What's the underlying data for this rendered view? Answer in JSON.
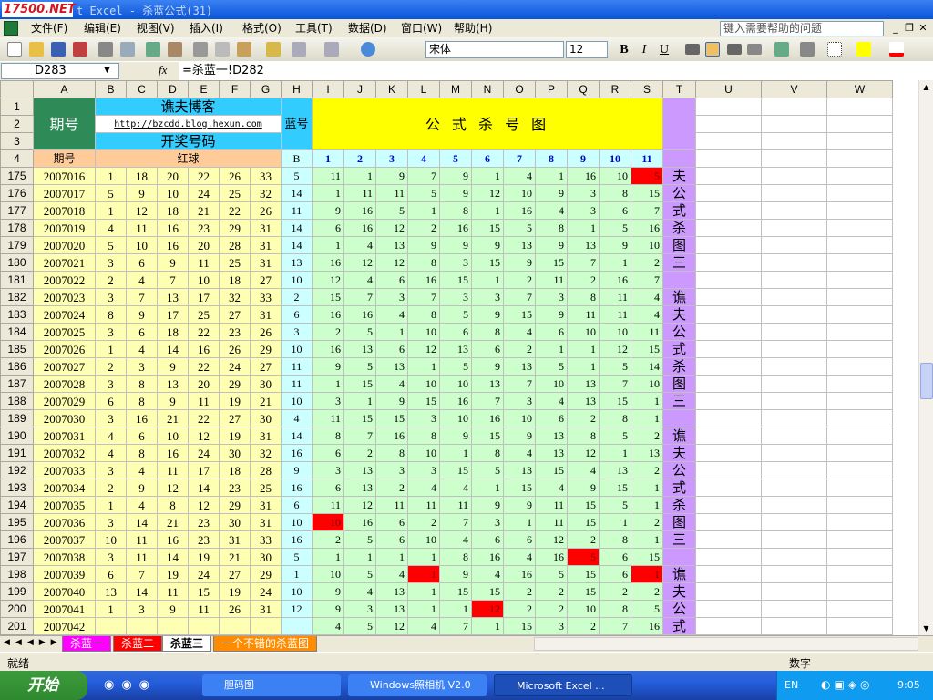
{
  "window": {
    "logo": "17500.NET",
    "title": "t Excel - 杀蓝公式(31)"
  },
  "menu": {
    "items": [
      "文件(F)",
      "编辑(E)",
      "视图(V)",
      "插入(I)",
      "格式(O)",
      "工具(T)",
      "数据(D)",
      "窗口(W)",
      "帮助(H)"
    ],
    "help_placeholder": "键入需要帮助的问题"
  },
  "toolbar": {
    "font": "宋体",
    "size": "12",
    "bold": "B",
    "italic": "I",
    "underline": "U"
  },
  "formula": {
    "namebox": "D283",
    "fx": "fx",
    "value": "=杀蓝一!D282"
  },
  "columns": [
    "A",
    "B",
    "C",
    "D",
    "E",
    "F",
    "G",
    "H",
    "I",
    "J",
    "K",
    "L",
    "M",
    "N",
    "O",
    "P",
    "Q",
    "R",
    "S",
    "T",
    "U",
    "V",
    "W"
  ],
  "header": {
    "period": "期号",
    "blog": "谯夫博客",
    "url": "http://bzcdd.blog.hexun.com",
    "draw": "开奖号码",
    "blue": "蓝号",
    "formula_title": "公 式 杀 号 图",
    "period2": "期号",
    "red": "红球",
    "B": "B",
    "nums": [
      "1",
      "2",
      "3",
      "4",
      "5",
      "6",
      "7",
      "8",
      "9",
      "10",
      "11"
    ]
  },
  "rows": [
    {
      "r": "175",
      "p": "2007016",
      "red": [
        "1",
        "18",
        "20",
        "22",
        "26",
        "33"
      ],
      "b": "5",
      "v": [
        "11",
        "1",
        "9",
        "7",
        "9",
        "1",
        "4",
        "1",
        "16",
        "10",
        "5"
      ],
      "hl": [
        10
      ]
    },
    {
      "r": "176",
      "p": "2007017",
      "red": [
        "5",
        "9",
        "10",
        "24",
        "25",
        "32"
      ],
      "b": "14",
      "v": [
        "1",
        "11",
        "11",
        "5",
        "9",
        "12",
        "10",
        "9",
        "3",
        "8",
        "15"
      ],
      "hl": []
    },
    {
      "r": "177",
      "p": "2007018",
      "red": [
        "1",
        "12",
        "18",
        "21",
        "22",
        "26"
      ],
      "b": "11",
      "v": [
        "9",
        "16",
        "5",
        "1",
        "8",
        "1",
        "16",
        "4",
        "3",
        "6",
        "7"
      ],
      "hl": []
    },
    {
      "r": "178",
      "p": "2007019",
      "red": [
        "4",
        "11",
        "16",
        "23",
        "29",
        "31"
      ],
      "b": "14",
      "v": [
        "6",
        "16",
        "12",
        "2",
        "16",
        "15",
        "5",
        "8",
        "1",
        "5",
        "16"
      ],
      "hl": []
    },
    {
      "r": "179",
      "p": "2007020",
      "red": [
        "5",
        "10",
        "16",
        "20",
        "28",
        "31"
      ],
      "b": "14",
      "v": [
        "1",
        "4",
        "13",
        "9",
        "9",
        "9",
        "13",
        "9",
        "13",
        "9",
        "10"
      ],
      "hl": []
    },
    {
      "r": "180",
      "p": "2007021",
      "red": [
        "3",
        "6",
        "9",
        "11",
        "25",
        "31"
      ],
      "b": "13",
      "v": [
        "16",
        "12",
        "12",
        "8",
        "3",
        "15",
        "9",
        "15",
        "7",
        "1",
        "2"
      ],
      "hl": []
    },
    {
      "r": "181",
      "p": "2007022",
      "red": [
        "2",
        "4",
        "7",
        "10",
        "18",
        "27"
      ],
      "b": "10",
      "v": [
        "12",
        "4",
        "6",
        "16",
        "15",
        "1",
        "2",
        "11",
        "2",
        "16",
        "7"
      ],
      "hl": []
    },
    {
      "r": "182",
      "p": "2007023",
      "red": [
        "3",
        "7",
        "13",
        "17",
        "32",
        "33"
      ],
      "b": "2",
      "v": [
        "15",
        "7",
        "3",
        "7",
        "3",
        "3",
        "7",
        "3",
        "8",
        "11",
        "4"
      ],
      "hl": []
    },
    {
      "r": "183",
      "p": "2007024",
      "red": [
        "8",
        "9",
        "17",
        "25",
        "27",
        "31"
      ],
      "b": "6",
      "v": [
        "16",
        "16",
        "4",
        "8",
        "5",
        "9",
        "15",
        "9",
        "11",
        "11",
        "4"
      ],
      "hl": []
    },
    {
      "r": "184",
      "p": "2007025",
      "red": [
        "3",
        "6",
        "18",
        "22",
        "23",
        "26"
      ],
      "b": "3",
      "v": [
        "2",
        "5",
        "1",
        "10",
        "6",
        "8",
        "4",
        "6",
        "10",
        "10",
        "11"
      ],
      "hl": []
    },
    {
      "r": "185",
      "p": "2007026",
      "red": [
        "1",
        "4",
        "14",
        "16",
        "26",
        "29"
      ],
      "b": "10",
      "v": [
        "16",
        "13",
        "6",
        "12",
        "13",
        "6",
        "2",
        "1",
        "1",
        "12",
        "15"
      ],
      "hl": []
    },
    {
      "r": "186",
      "p": "2007027",
      "red": [
        "2",
        "3",
        "9",
        "22",
        "24",
        "27"
      ],
      "b": "11",
      "v": [
        "9",
        "5",
        "13",
        "1",
        "5",
        "9",
        "13",
        "5",
        "1",
        "5",
        "14"
      ],
      "hl": []
    },
    {
      "r": "187",
      "p": "2007028",
      "red": [
        "3",
        "8",
        "13",
        "20",
        "29",
        "30"
      ],
      "b": "11",
      "v": [
        "1",
        "15",
        "4",
        "10",
        "10",
        "13",
        "7",
        "10",
        "13",
        "7",
        "10"
      ],
      "hl": []
    },
    {
      "r": "188",
      "p": "2007029",
      "red": [
        "6",
        "8",
        "9",
        "11",
        "19",
        "21"
      ],
      "b": "10",
      "v": [
        "3",
        "1",
        "9",
        "15",
        "16",
        "7",
        "3",
        "4",
        "13",
        "15",
        "1"
      ],
      "hl": []
    },
    {
      "r": "189",
      "p": "2007030",
      "red": [
        "3",
        "16",
        "21",
        "22",
        "27",
        "30"
      ],
      "b": "4",
      "v": [
        "11",
        "15",
        "15",
        "3",
        "10",
        "16",
        "10",
        "6",
        "2",
        "8",
        "1"
      ],
      "hl": []
    },
    {
      "r": "190",
      "p": "2007031",
      "red": [
        "4",
        "6",
        "10",
        "12",
        "19",
        "31"
      ],
      "b": "14",
      "v": [
        "8",
        "7",
        "16",
        "8",
        "9",
        "15",
        "9",
        "13",
        "8",
        "5",
        "2"
      ],
      "hl": []
    },
    {
      "r": "191",
      "p": "2007032",
      "red": [
        "4",
        "8",
        "16",
        "24",
        "30",
        "32"
      ],
      "b": "16",
      "v": [
        "6",
        "2",
        "8",
        "10",
        "1",
        "8",
        "4",
        "13",
        "12",
        "1",
        "13"
      ],
      "hl": []
    },
    {
      "r": "192",
      "p": "2007033",
      "red": [
        "3",
        "4",
        "11",
        "17",
        "18",
        "28"
      ],
      "b": "9",
      "v": [
        "3",
        "13",
        "3",
        "3",
        "15",
        "5",
        "13",
        "15",
        "4",
        "13",
        "2"
      ],
      "hl": []
    },
    {
      "r": "193",
      "p": "2007034",
      "red": [
        "2",
        "9",
        "12",
        "14",
        "23",
        "25"
      ],
      "b": "16",
      "v": [
        "6",
        "13",
        "2",
        "4",
        "4",
        "1",
        "15",
        "4",
        "9",
        "15",
        "1"
      ],
      "hl": []
    },
    {
      "r": "194",
      "p": "2007035",
      "red": [
        "1",
        "4",
        "8",
        "12",
        "29",
        "31"
      ],
      "b": "6",
      "v": [
        "11",
        "12",
        "11",
        "11",
        "11",
        "9",
        "9",
        "11",
        "15",
        "5",
        "1"
      ],
      "hl": []
    },
    {
      "r": "195",
      "p": "2007036",
      "red": [
        "3",
        "14",
        "21",
        "23",
        "30",
        "31"
      ],
      "b": "10",
      "v": [
        "10",
        "16",
        "6",
        "2",
        "7",
        "3",
        "1",
        "11",
        "15",
        "1",
        "2"
      ],
      "hl": [
        0
      ]
    },
    {
      "r": "196",
      "p": "2007037",
      "red": [
        "10",
        "11",
        "16",
        "23",
        "31",
        "33"
      ],
      "b": "16",
      "v": [
        "2",
        "5",
        "6",
        "10",
        "4",
        "6",
        "6",
        "12",
        "2",
        "8",
        "1"
      ],
      "hl": []
    },
    {
      "r": "197",
      "p": "2007038",
      "red": [
        "3",
        "11",
        "14",
        "19",
        "21",
        "30"
      ],
      "b": "5",
      "v": [
        "1",
        "1",
        "1",
        "1",
        "8",
        "16",
        "4",
        "16",
        "5",
        "6",
        "15"
      ],
      "hl": [
        8
      ]
    },
    {
      "r": "198",
      "p": "2007039",
      "red": [
        "6",
        "7",
        "19",
        "24",
        "27",
        "29"
      ],
      "b": "1",
      "v": [
        "10",
        "5",
        "4",
        "1",
        "9",
        "4",
        "16",
        "5",
        "15",
        "6",
        "1"
      ],
      "hl": [
        3,
        10
      ]
    },
    {
      "r": "199",
      "p": "2007040",
      "red": [
        "13",
        "14",
        "11",
        "15",
        "19",
        "24"
      ],
      "b": "10",
      "v": [
        "9",
        "4",
        "13",
        "1",
        "15",
        "15",
        "2",
        "2",
        "15",
        "2",
        "2"
      ],
      "hl": []
    },
    {
      "r": "200",
      "p": "2007041",
      "red": [
        "1",
        "3",
        "9",
        "11",
        "26",
        "31"
      ],
      "b": "12",
      "v": [
        "9",
        "3",
        "13",
        "1",
        "1",
        "12",
        "2",
        "2",
        "10",
        "8",
        "5"
      ],
      "hl": [
        5
      ]
    },
    {
      "r": "201",
      "p": "2007042",
      "red": [
        "",
        "",
        "",
        "",
        "",
        ""
      ],
      "b": "",
      "v": [
        "4",
        "5",
        "12",
        "4",
        "7",
        "1",
        "15",
        "3",
        "2",
        "7",
        "16"
      ],
      "hl": []
    }
  ],
  "side_text": [
    "夫",
    "公",
    "式",
    "杀",
    "图",
    "三",
    "",
    "谯",
    "夫",
    "公",
    "式",
    "杀",
    "图",
    "三",
    "",
    "谯",
    "夫",
    "公",
    "式",
    "杀",
    "图",
    "三",
    "",
    "谯",
    "夫",
    "公",
    "式"
  ],
  "sheets": [
    "杀蓝一",
    "杀蓝二",
    "杀蓝三",
    "一个不错的杀蓝图"
  ],
  "status": {
    "ready": "就绪",
    "mode": "数字"
  },
  "taskbar": {
    "start": "开始",
    "tasks": [
      "胆码图",
      "Windows照相机 V2.0",
      "Microsoft Excel ..."
    ],
    "lang": "EN",
    "time": "9:05"
  },
  "colors": {
    "titlebar": "#0a54d8",
    "highlight": "#ff0000",
    "lavender": "#cc99ff",
    "yellow": "#ffffb4",
    "green": "#ccffcc",
    "header_cyan": "#33ccff",
    "header_yellow": "#ffff00",
    "header_green": "#2e8b57"
  }
}
